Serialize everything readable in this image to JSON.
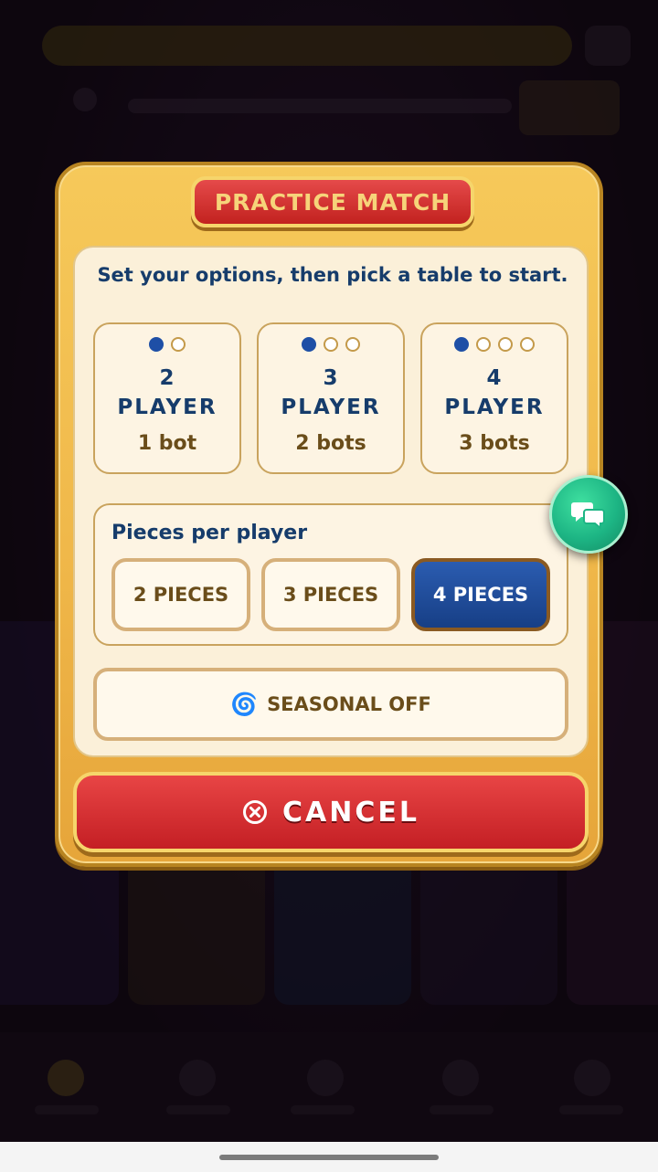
{
  "modal": {
    "title": "PRACTICE MATCH",
    "instruction": "Set your options, then pick a table to start."
  },
  "player_options": [
    {
      "number": "2",
      "label": "PLAYER",
      "bots": "1 bot",
      "dots_total": 2,
      "dots_filled": 1
    },
    {
      "number": "3",
      "label": "PLAYER",
      "bots": "2 bots",
      "dots_total": 3,
      "dots_filled": 1
    },
    {
      "number": "4",
      "label": "PLAYER",
      "bots": "3 bots",
      "dots_total": 4,
      "dots_filled": 1
    }
  ],
  "pieces": {
    "title": "Pieces per player",
    "options": [
      "2 PIECES",
      "3 PIECES",
      "4 PIECES"
    ],
    "selected": "4 PIECES"
  },
  "seasonal": {
    "icon": "swirl-icon",
    "label": "SEASONAL OFF"
  },
  "cancel": {
    "icon": "close-circle-icon",
    "label": "CANCEL"
  },
  "chat_fab": {
    "icon": "chat-bubbles-icon"
  },
  "colors": {
    "accent_blue": "#1e4fa6",
    "cancel_red": "#c41f24",
    "modal_gold": "#f0b84a",
    "text_navy": "#163c6b",
    "chat_green": "#1db584"
  }
}
